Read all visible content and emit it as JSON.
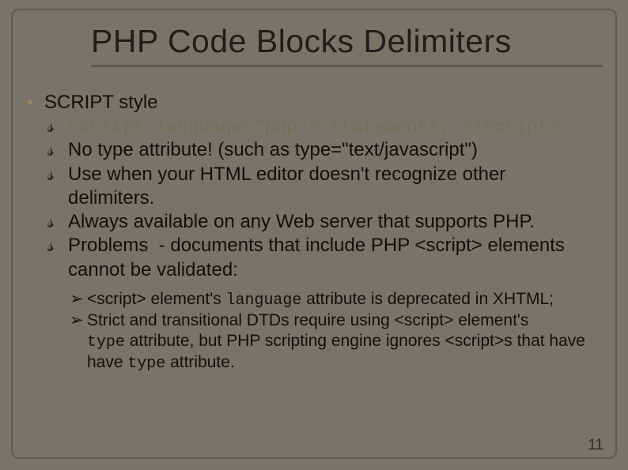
{
  "title": "PHP Code Blocks Delimiters",
  "bullets": {
    "l1": "SCRIPT style",
    "code_open": "<script language=\"php\">",
    "code_stmt": " statements; ",
    "code_close": "</script>",
    "no_type": "No type attribute! (such as type=\"text/javascript\")",
    "use_when": "Use when your HTML editor doesn't recognize other delimiters.",
    "always": "Always available on any Web server that supports PHP.",
    "problems": "Problems  - documents that include PHP <script> elements cannot be validated:",
    "sub1_pre": "<script> element's ",
    "sub1_mono": "language",
    "sub1_post": " attribute is deprecated in XHTML;",
    "sub2_line1": "Strict and transitional DTDs require using <script> element's ",
    "sub2_mono1": "type",
    "sub2_mid": " attribute, but PHP scripting engine ignores <script>s that have ",
    "sub2_mono2": "type",
    "sub2_end": " attribute."
  },
  "page_number": "11"
}
